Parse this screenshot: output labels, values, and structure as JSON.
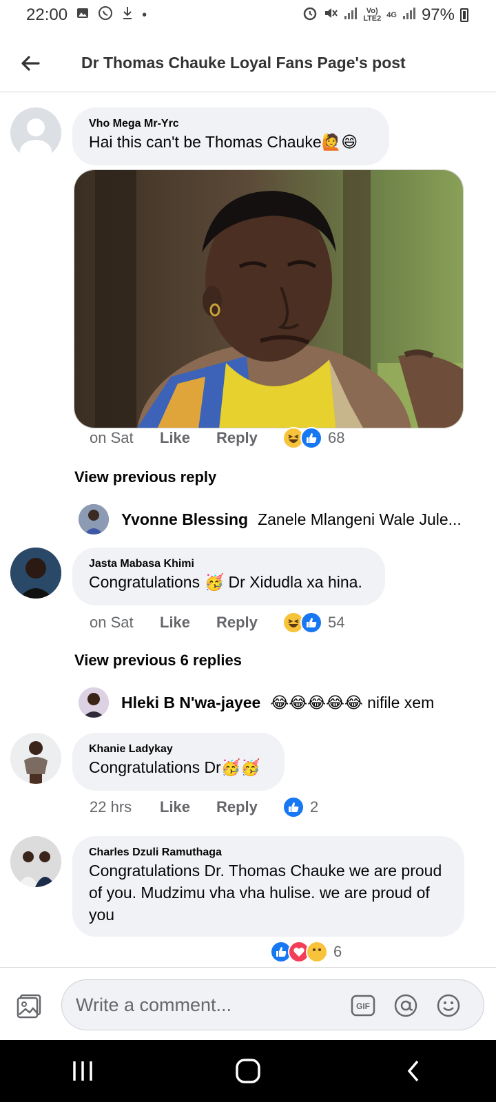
{
  "status_bar": {
    "time": "22:00",
    "network_top": "Vo)",
    "network_bottom": "LTE2",
    "gen": "4G",
    "battery": "97%"
  },
  "header": {
    "title": "Dr Thomas Chauke Loyal Fans Page's post"
  },
  "comments": [
    {
      "name": "Vho Mega Mr-Yrc",
      "text": "Hai this can't  be Thomas Chauke🙋😄",
      "time": "on Sat",
      "like": "Like",
      "reply": "Reply",
      "reactions": [
        "haha",
        "like"
      ],
      "count": "68",
      "view_previous": "View previous reply",
      "reply_preview": {
        "name": "Yvonne Blessing",
        "text": "Zanele Mlangeni Wale Jule..."
      }
    },
    {
      "name": "Jasta Mabasa Khimi",
      "text": "Congratulations 🥳 Dr Xidudla xa hina.",
      "time": "on Sat",
      "like": "Like",
      "reply": "Reply",
      "reactions": [
        "haha",
        "like"
      ],
      "count": "54",
      "view_previous": "View previous 6 replies",
      "reply_preview": {
        "name": "Hleki B N'wa-jayee",
        "text": "😂😂😂😂😂 nifile xem"
      }
    },
    {
      "name": "Khanie Ladykay",
      "text": "Congratulations Dr🥳🥳",
      "time": "22 hrs",
      "like": "Like",
      "reply": "Reply",
      "reactions": [
        "like"
      ],
      "count": "2"
    },
    {
      "name": "Charles Dzuli Ramuthaga",
      "text": "Congratulations Dr. Thomas Chauke we are proud of you. Mudzimu vha vha hulise. we are proud of you",
      "reactions": [
        "like",
        "love",
        "care"
      ],
      "count": "6"
    }
  ],
  "composer": {
    "placeholder": "Write a comment...",
    "gif_label": "GIF"
  },
  "colors": {
    "bubble": "#f0f2f5",
    "like_blue": "#1877f2",
    "haha_yellow": "#f7c33b",
    "secondary_text": "#65676b"
  }
}
